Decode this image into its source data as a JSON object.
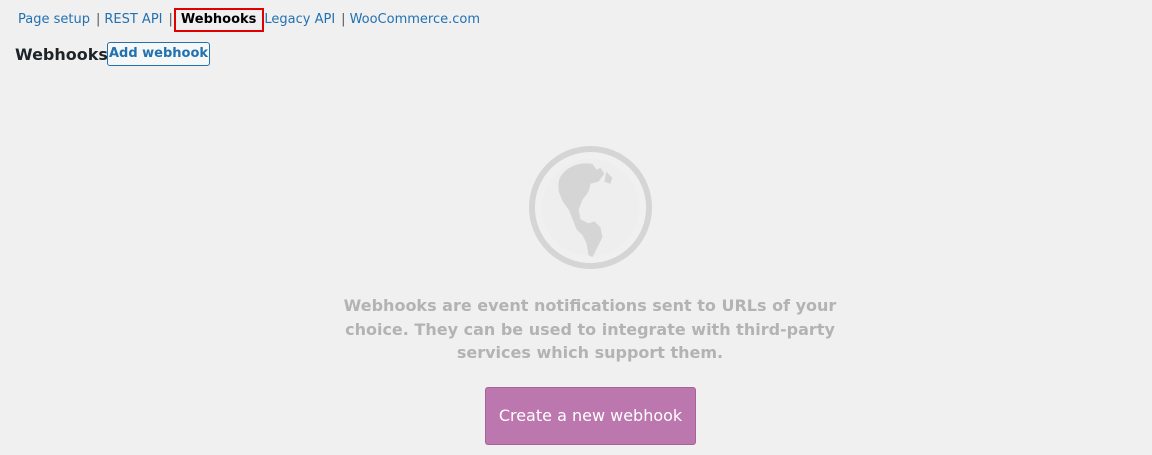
{
  "subnav": {
    "items": [
      {
        "label": "Page setup",
        "current": false
      },
      {
        "label": "REST API",
        "current": false
      },
      {
        "label": "Webhooks",
        "current": true
      },
      {
        "label": "Legacy API",
        "current": false
      },
      {
        "label": "WooCommerce.com",
        "current": false
      }
    ],
    "separator": "|"
  },
  "header": {
    "title": "Webhooks",
    "add_button_label": "Add webhook"
  },
  "empty_state": {
    "icon": "globe-icon",
    "message": "Webhooks are event notifications sent to URLs of your choice. They can be used to integrate with third-party services which support them.",
    "cta_label": "Create a new webhook"
  },
  "colors": {
    "background": "#f0f0f1",
    "link": "#2271b1",
    "accent_button": "#bb77ae",
    "highlight_outline": "#e00000",
    "muted_text": "#b3b3b3"
  }
}
